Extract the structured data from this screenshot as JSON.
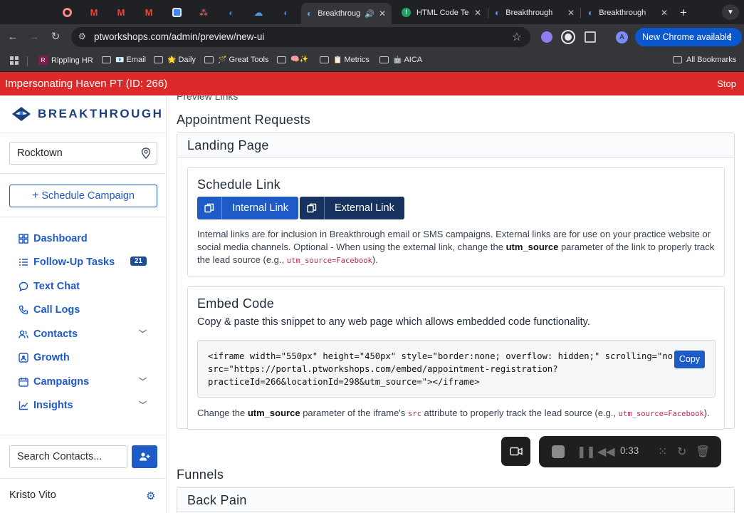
{
  "browser": {
    "tabs": [
      {
        "label": "",
        "icon": "record-icon",
        "color": "#f28b82"
      },
      {
        "label": "",
        "icon": "gmail-icon",
        "color": "#ea4335"
      },
      {
        "label": "",
        "icon": "gmail-icon",
        "color": "#ea4335"
      },
      {
        "label": "",
        "icon": "gmail-icon",
        "color": "#ea4335"
      },
      {
        "label": "",
        "icon": "calendar-icon",
        "color": "#4285f4"
      },
      {
        "label": "",
        "icon": "asana-icon",
        "color": "#f06a6a"
      },
      {
        "label": "",
        "icon": "breakthrough-icon",
        "color": "#4a80d8"
      },
      {
        "label": "",
        "icon": "cloud-icon",
        "color": "#4f9de8"
      },
      {
        "label": "",
        "icon": "breakthrough-icon",
        "color": "#4a80d8"
      },
      {
        "label": "Breakthrough",
        "icon": "breakthrough-icon",
        "active": true
      },
      {
        "label": "HTML Code Te",
        "icon": "green-f-icon"
      },
      {
        "label": "Breakthrough",
        "icon": "breakthrough-icon"
      },
      {
        "label": "Breakthrough",
        "icon": "breakthrough-icon"
      }
    ],
    "url": "ptworkshops.com/admin/preview/new-ui",
    "profile_initial": "A",
    "new_chrome_label": "New Chrome available",
    "bookmarks": [
      {
        "label": "Rippling HR",
        "icon": "rippling-icon"
      },
      {
        "label": "Email",
        "icon": "folder-icon",
        "emoji": "📧"
      },
      {
        "label": "Daily",
        "icon": "folder-icon",
        "emoji": "🌟"
      },
      {
        "label": "Great Tools",
        "icon": "folder-icon",
        "emoji": "🪄"
      },
      {
        "label": "",
        "icon": "folder-icon",
        "emoji": "🧠✨"
      },
      {
        "label": "Metrics",
        "icon": "folder-icon",
        "emoji": "📋"
      },
      {
        "label": "AICA",
        "icon": "folder-icon",
        "emoji": "🤖"
      }
    ],
    "all_bookmarks_label": "All Bookmarks"
  },
  "banner": {
    "text": "Impersonating Haven PT (ID: 266)",
    "stop_label": "Stop",
    "color": "#dc2a2a"
  },
  "sidebar": {
    "logo_text": "BREAKTHROUGH",
    "location_value": "Rocktown",
    "schedule_campaign_label": "Schedule Campaign",
    "nav_items": [
      {
        "label": "Dashboard",
        "icon": "dashboard-icon"
      },
      {
        "label": "Follow-Up Tasks",
        "icon": "list-icon",
        "badge": "21"
      },
      {
        "label": "Text Chat",
        "icon": "chat-icon"
      },
      {
        "label": "Call Logs",
        "icon": "phone-icon"
      },
      {
        "label": "Contacts",
        "icon": "contacts-icon",
        "expandable": true
      },
      {
        "label": "Growth",
        "icon": "growth-icon"
      },
      {
        "label": "Campaigns",
        "icon": "calendar-icon",
        "expandable": true
      },
      {
        "label": "Insights",
        "icon": "chart-icon",
        "expandable": true
      }
    ],
    "search_placeholder": "Search Contacts...",
    "user_name": "Kristo Vito"
  },
  "main": {
    "preview_links_label": "Preview Links",
    "heading": "Appointment Requests",
    "landing_card_title": "Landing Page",
    "schedule_link": {
      "title": "Schedule Link",
      "internal_label": "Internal Link",
      "external_label": "External Link",
      "description_1": "Internal links are for inclusion in Breakthrough email or SMS campaigns. External links are for use on your practice website or social media channels. Optional - When using the external link, change the",
      "param_name": "utm_source",
      "description_2": "parameter of the link to properly track the lead source (e.g.,",
      "example_code": "utm_source=Facebook",
      "description_end": ")."
    },
    "embed_code": {
      "title": "Embed Code",
      "instructions": "Copy & paste this snippet to any web page which allows embedded code functionality.",
      "snippet": "<iframe width=\"550px\" height=\"450px\" style=\"border:none; overflow: hidden;\" scrolling=\"no\"\nsrc=\"https://portal.ptworkshops.com/embed/appointment-registration?\npracticeId=266&locationId=298&utm_source=\"></iframe>",
      "copy_label": "Copy",
      "footer_1": "Change the",
      "param_name": "utm_source",
      "footer_2": "parameter of the iframe's",
      "src_attr": "src",
      "footer_3": "attribute to properly track the lead source (e.g.,",
      "example_code": "utm_source=Facebook",
      "footer_end": ")."
    },
    "funnels_heading": "Funnels",
    "back_pain_title": "Back Pain"
  },
  "recorder": {
    "time": "0:33"
  }
}
